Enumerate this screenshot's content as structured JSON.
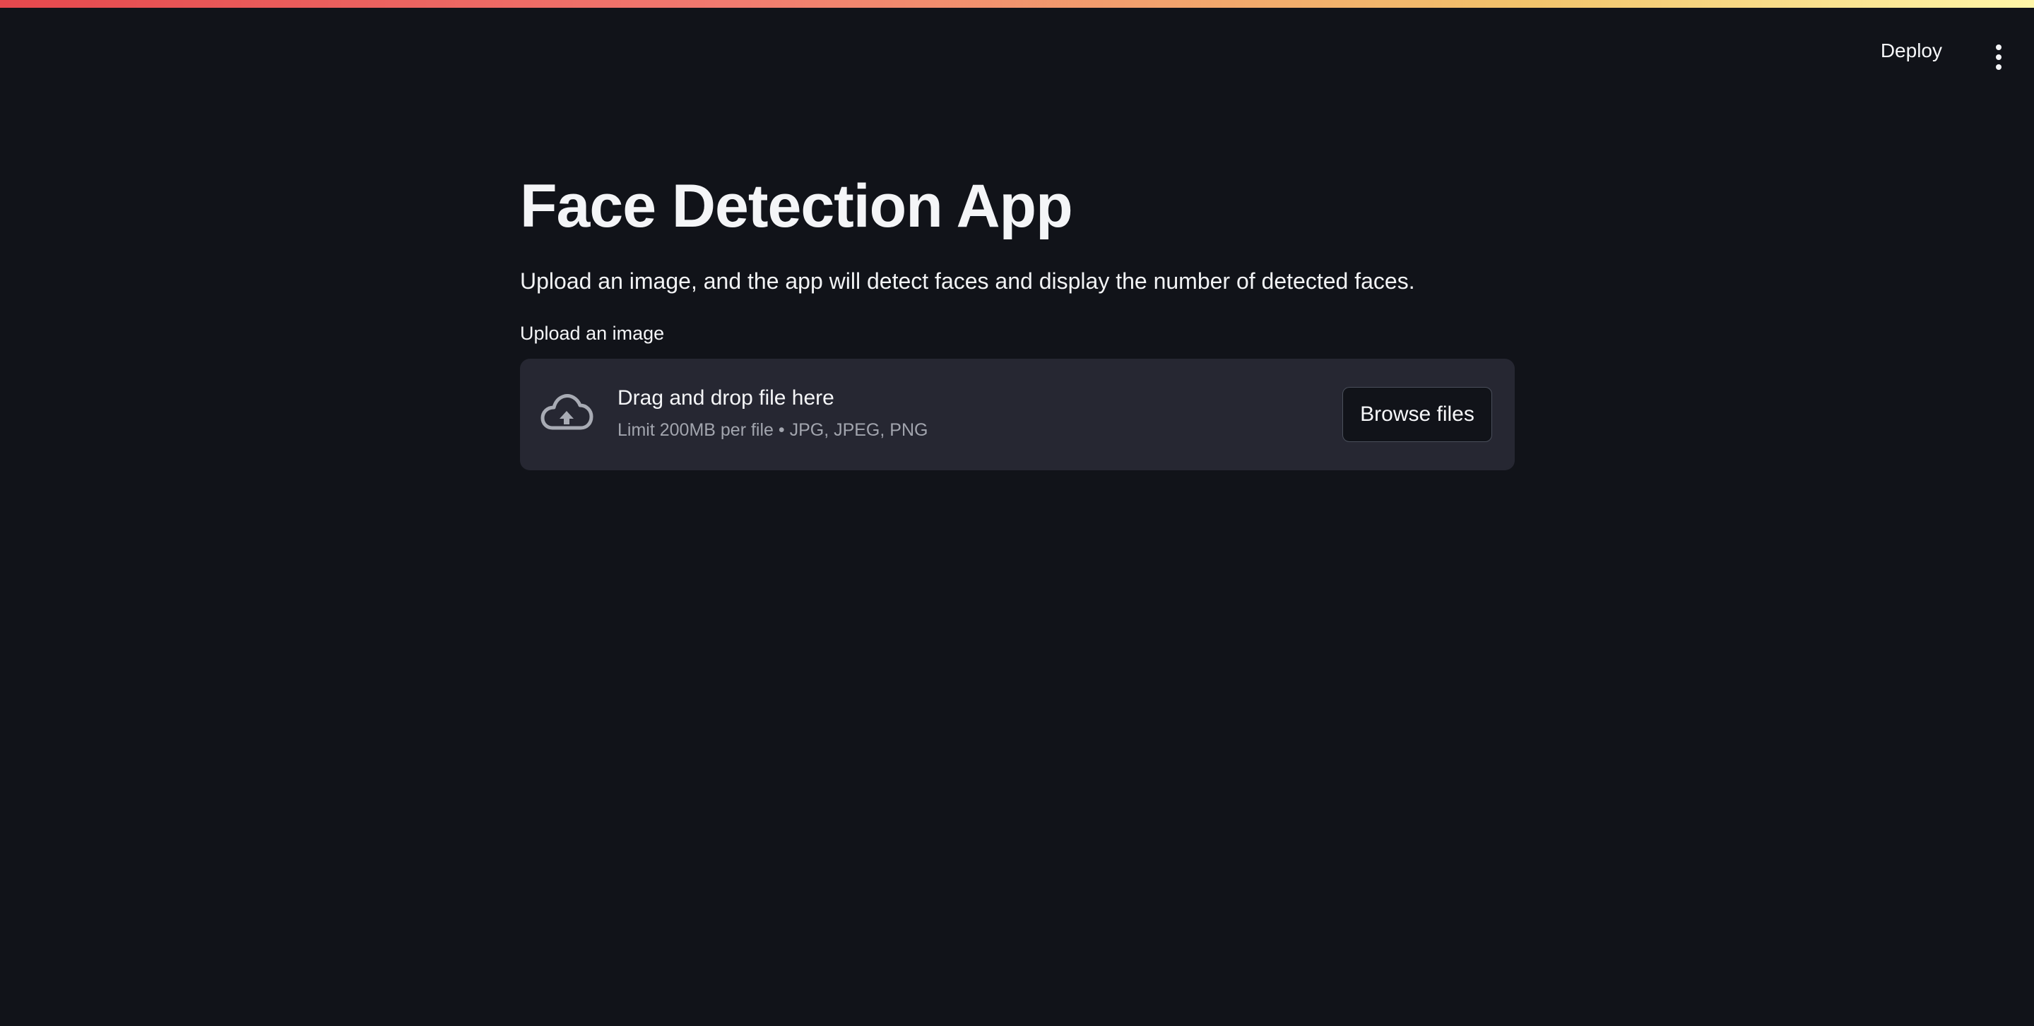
{
  "header": {
    "deploy_label": "Deploy",
    "menu_icon": "vertical-ellipsis-icon"
  },
  "main": {
    "title": "Face Detection App",
    "description": "Upload an image, and the app will detect faces and display the number of detected faces."
  },
  "uploader": {
    "label": "Upload an image",
    "icon": "cloud-upload-icon",
    "dropzone_title": "Drag and drop file here",
    "limit_text": "Limit 200MB per file • JPG, JPEG, PNG",
    "browse_label": "Browse files"
  },
  "colors": {
    "background": "#111319",
    "dropzone": "#262732",
    "muted_text": "#a2a5ae",
    "decoration_start": "#e5484d",
    "decoration_end": "#fff6a8"
  }
}
